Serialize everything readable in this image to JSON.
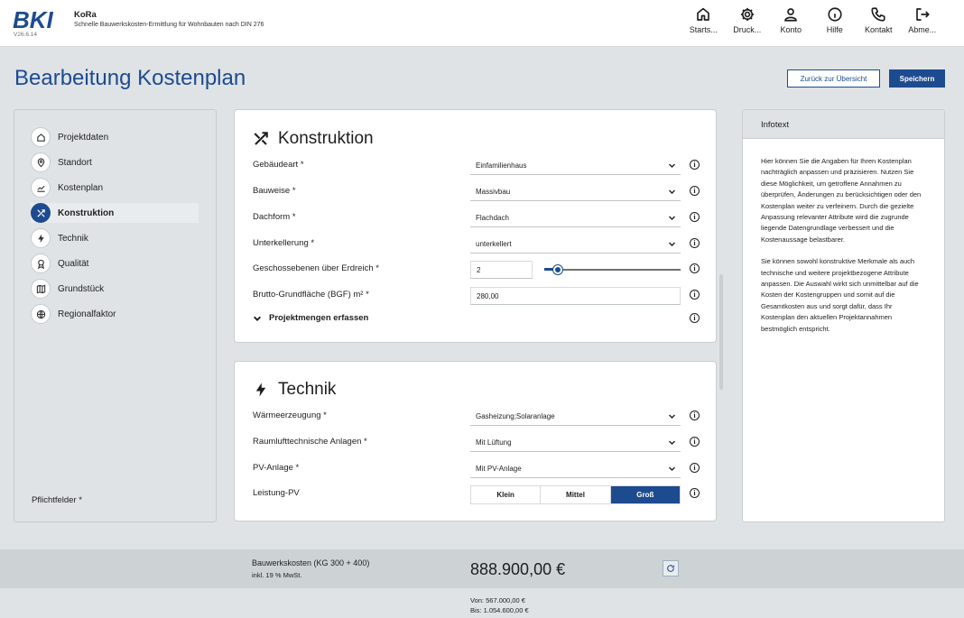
{
  "app": {
    "logo": "BKI",
    "version": "V26.6.14",
    "title": "KoRa",
    "subtitle": "Schnelle Bauwerkskosten-Ermittlung für Wohnbauten nach DIN 276"
  },
  "nav": [
    {
      "label": "Starts...",
      "icon": "home-icon"
    },
    {
      "label": "Druck...",
      "icon": "gear-icon"
    },
    {
      "label": "Konto",
      "icon": "user-icon"
    },
    {
      "label": "Hilfe",
      "icon": "info-icon"
    },
    {
      "label": "Kontakt",
      "icon": "phone-icon"
    },
    {
      "label": "Abme...",
      "icon": "logout-icon"
    }
  ],
  "page": {
    "title": "Bearbeitung Kostenplan",
    "back_label": "Zurück zur Übersicht",
    "save_label": "Speichern"
  },
  "sidebar": {
    "items": [
      {
        "label": "Projektdaten",
        "icon": "home-icon"
      },
      {
        "label": "Standort",
        "icon": "location-pin-icon"
      },
      {
        "label": "Kostenplan",
        "icon": "chart-icon"
      },
      {
        "label": "Konstruktion",
        "icon": "tools-icon",
        "active": true
      },
      {
        "label": "Technik",
        "icon": "lightning-icon"
      },
      {
        "label": "Qualität",
        "icon": "award-icon"
      },
      {
        "label": "Grundstück",
        "icon": "map-icon"
      },
      {
        "label": "Regionalfaktor",
        "icon": "globe-icon"
      }
    ],
    "required_note": "Pflichtfelder *"
  },
  "konstruktion": {
    "title": "Konstruktion",
    "fields": [
      {
        "label": "Gebäudeart *",
        "value": "Einfamilienhaus"
      },
      {
        "label": "Bauweise *",
        "value": "Massivbau"
      },
      {
        "label": "Dachform *",
        "value": "Flachdach"
      },
      {
        "label": "Unterkellerung *",
        "value": "unterkellert"
      }
    ],
    "geschosse": {
      "label": "Geschossebenen über Erdreich *",
      "value": "2",
      "slider_fraction": 0.1
    },
    "bgf": {
      "label": "Brutto-Grundfläche (BGF) m² *",
      "value": "280,00"
    },
    "expander": "Projektmengen erfassen"
  },
  "technik": {
    "title": "Technik",
    "fields": [
      {
        "label": "Wärmeerzeugung *",
        "value": "Gasheizung;Solaranlage"
      },
      {
        "label": "Raumlufttechnische Anlagen *",
        "value": "Mit Lüftung"
      },
      {
        "label": "PV-Anlage *",
        "value": "Mit PV-Anlage"
      }
    ],
    "leistung": {
      "label": "Leistung-PV",
      "options": [
        "Klein",
        "Mittel",
        "Groß"
      ],
      "selected": "Groß"
    }
  },
  "infotext": {
    "title": "Infotext",
    "p1": "Hier können Sie die Angaben für Ihren Kostenplan nachträglich anpassen und präzisieren. Nutzen Sie diese Möglichkeit, um getroffene Annahmen zu überprüfen, Änderungen zu berücksichtigen oder den Kostenplan weiter zu verfeinern. Durch die gezielte Anpassung relevanter Attribute wird die zugrunde liegende Datengrundlage verbessert und die Kostenaussage belastbarer.",
    "p2": "Sie können sowohl konstruktive Merkmale als auch technische und weitere projektbezogene Attribute anpassen. Die Auswahl wirkt sich unmittelbar auf die Kosten der Kostengruppen und somit auf die Gesamtkosten aus und sorgt dafür, dass Ihr Kostenplan den aktuellen Projektannahmen bestmöglich entspricht."
  },
  "footer": {
    "label": "Bauwerkskosten (KG 300 + 400)",
    "sub": "inkl. 19 % MwSt.",
    "value": "888.900,00 €",
    "von": "Von:   567.000,00 €",
    "bis": "Bis:  1.054.600,00 €"
  },
  "colors": {
    "brand": "#1d4b8f",
    "background": "#dfe3e6"
  }
}
